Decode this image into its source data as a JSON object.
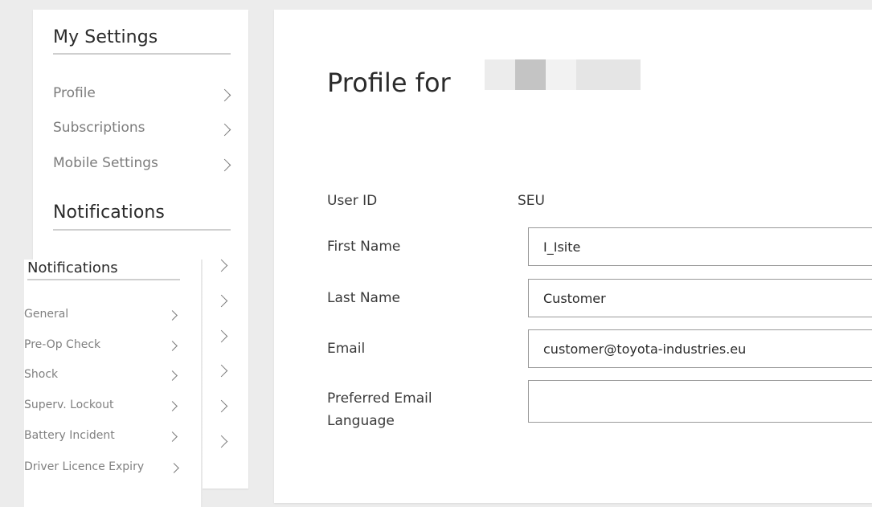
{
  "settings": {
    "my_settings_title": "My Settings",
    "items": [
      {
        "label": "Profile"
      },
      {
        "label": "Subscriptions"
      },
      {
        "label": "Mobile Settings"
      }
    ],
    "notifications_title": "Notifications"
  },
  "notifications_panel": {
    "title": "Notifications",
    "items": [
      {
        "label": "General"
      },
      {
        "label": "Pre-Op Check"
      },
      {
        "label": "Shock"
      },
      {
        "label": "Superv. Lockout"
      },
      {
        "label": "Battery Incident"
      },
      {
        "label": "Driver Licence Expiry"
      }
    ]
  },
  "profile": {
    "title": "Profile for",
    "user_id_label": "User ID",
    "user_id_value": "SEU",
    "first_name_label": "First Name",
    "first_name_value": "I_Isite",
    "last_name_label": "Last Name",
    "last_name_value": "Customer",
    "email_label": "Email",
    "email_value": "customer@toyota-industries.eu",
    "language_label_line1": "Preferred Email",
    "language_label_line2": "Language",
    "language_value": ""
  },
  "icons": {
    "nav_chevron": "chevron-right-icon"
  },
  "colors": {
    "background": "#ececec",
    "card": "#ffffff",
    "muted_text": "#7c7c7c",
    "heading_text": "#2b2b2b",
    "input_border": "#9a9a9a"
  }
}
